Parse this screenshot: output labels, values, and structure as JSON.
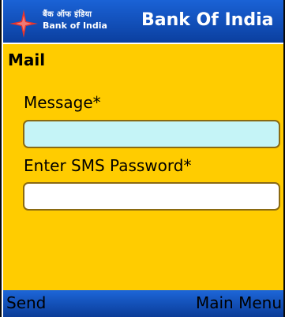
{
  "header": {
    "logo_hindi": "बैंक ऑफ इंडिया",
    "logo_english": "Bank of India",
    "title": "Bank Of India"
  },
  "page": {
    "title": "Mail"
  },
  "form": {
    "message_label": "Message*",
    "message_value": "",
    "password_label": "Enter SMS Password*",
    "password_value": ""
  },
  "softkeys": {
    "left": "Send",
    "right": "Main Menu"
  },
  "colors": {
    "header_blue": "#1a62d6",
    "body_yellow": "#ffcc00",
    "active_field": "#c5f4f7",
    "logo_star": "#e8342b"
  },
  "icons": {
    "logo": "bank-of-india-star-icon"
  }
}
